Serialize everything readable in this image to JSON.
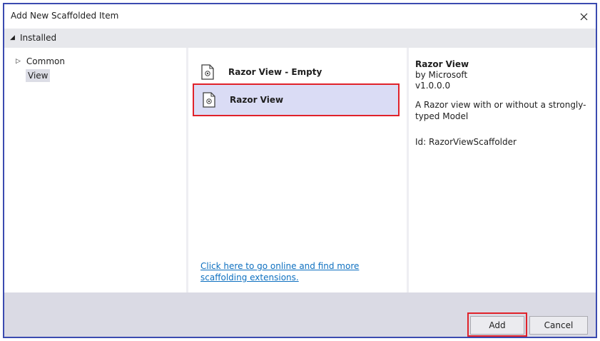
{
  "dialog": {
    "title": "Add New Scaffolded Item",
    "close_glyph": "✕"
  },
  "installed": {
    "label": "Installed",
    "arrow_glyph": "◢"
  },
  "tree": {
    "common_label": "Common",
    "common_arrow": "▷",
    "view_label": "View"
  },
  "templates": [
    {
      "name": "Razor View - Empty",
      "icon": "razor-file-icon",
      "selected": false
    },
    {
      "name": "Razor View",
      "icon": "razor-file-icon",
      "selected": true
    }
  ],
  "online_link": "Click here to go online and find more scaffolding extensions.",
  "details": {
    "title": "Razor View",
    "author": "by Microsoft",
    "version": "v1.0.0.0",
    "description": "A Razor view with or without a strongly-typed Model",
    "id": "Id: RazorViewScaffolder"
  },
  "buttons": {
    "add": "Add",
    "cancel": "Cancel"
  },
  "colors": {
    "window_border": "#3b4bb0",
    "highlight_border": "#e0222a",
    "selected_bg": "#dadcf5",
    "link": "#0e70c0"
  }
}
